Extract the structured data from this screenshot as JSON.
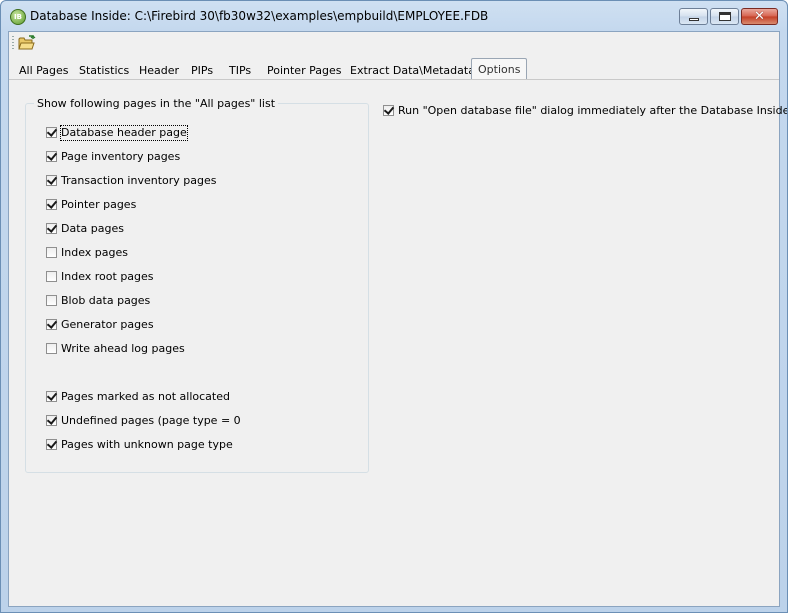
{
  "window": {
    "title": "Database Inside: C:\\Firebird 30\\fb30w32\\examples\\empbuild\\EMPLOYEE.FDB",
    "app_icon_text": "IB",
    "close_glyph": "✕"
  },
  "toolbar": {
    "open_icon": "folder-open-icon"
  },
  "tabs": [
    {
      "label": "All Pages",
      "active": false
    },
    {
      "label": "Statistics",
      "active": false
    },
    {
      "label": "Header",
      "active": false
    },
    {
      "label": "PIPs",
      "active": false
    },
    {
      "label": "TIPs",
      "active": false
    },
    {
      "label": "Pointer Pages",
      "active": false
    },
    {
      "label": "Extract Data\\Metadata",
      "active": false
    },
    {
      "label": "Options",
      "active": true
    }
  ],
  "options": {
    "group_title": "Show following pages in the \"All pages\" list",
    "page_types": [
      {
        "label": "Database header page",
        "checked": true
      },
      {
        "label": "Page inventory pages",
        "checked": true
      },
      {
        "label": "Transaction inventory pages",
        "checked": true
      },
      {
        "label": "Pointer pages",
        "checked": true
      },
      {
        "label": "Data pages",
        "checked": true
      },
      {
        "label": "Index pages",
        "checked": false
      },
      {
        "label": "Index root pages",
        "checked": false
      },
      {
        "label": "Blob data pages",
        "checked": false
      },
      {
        "label": "Generator pages",
        "checked": true
      },
      {
        "label": "Write ahead log pages",
        "checked": false
      }
    ],
    "extra_types": [
      {
        "label": "Pages marked as not allocated",
        "checked": true
      },
      {
        "label": "Undefined pages (page type = 0",
        "checked": true
      },
      {
        "label": "Pages with unknown page type",
        "checked": true
      }
    ],
    "run_open_dialog": {
      "label": "Run \"Open database file\" dialog immediately after the Database Inside starts",
      "checked": true
    }
  },
  "colors": {
    "title_gradient": "#c4d8ee",
    "close_button": "#c43e26",
    "panel_bg": "#f0f0f0"
  }
}
